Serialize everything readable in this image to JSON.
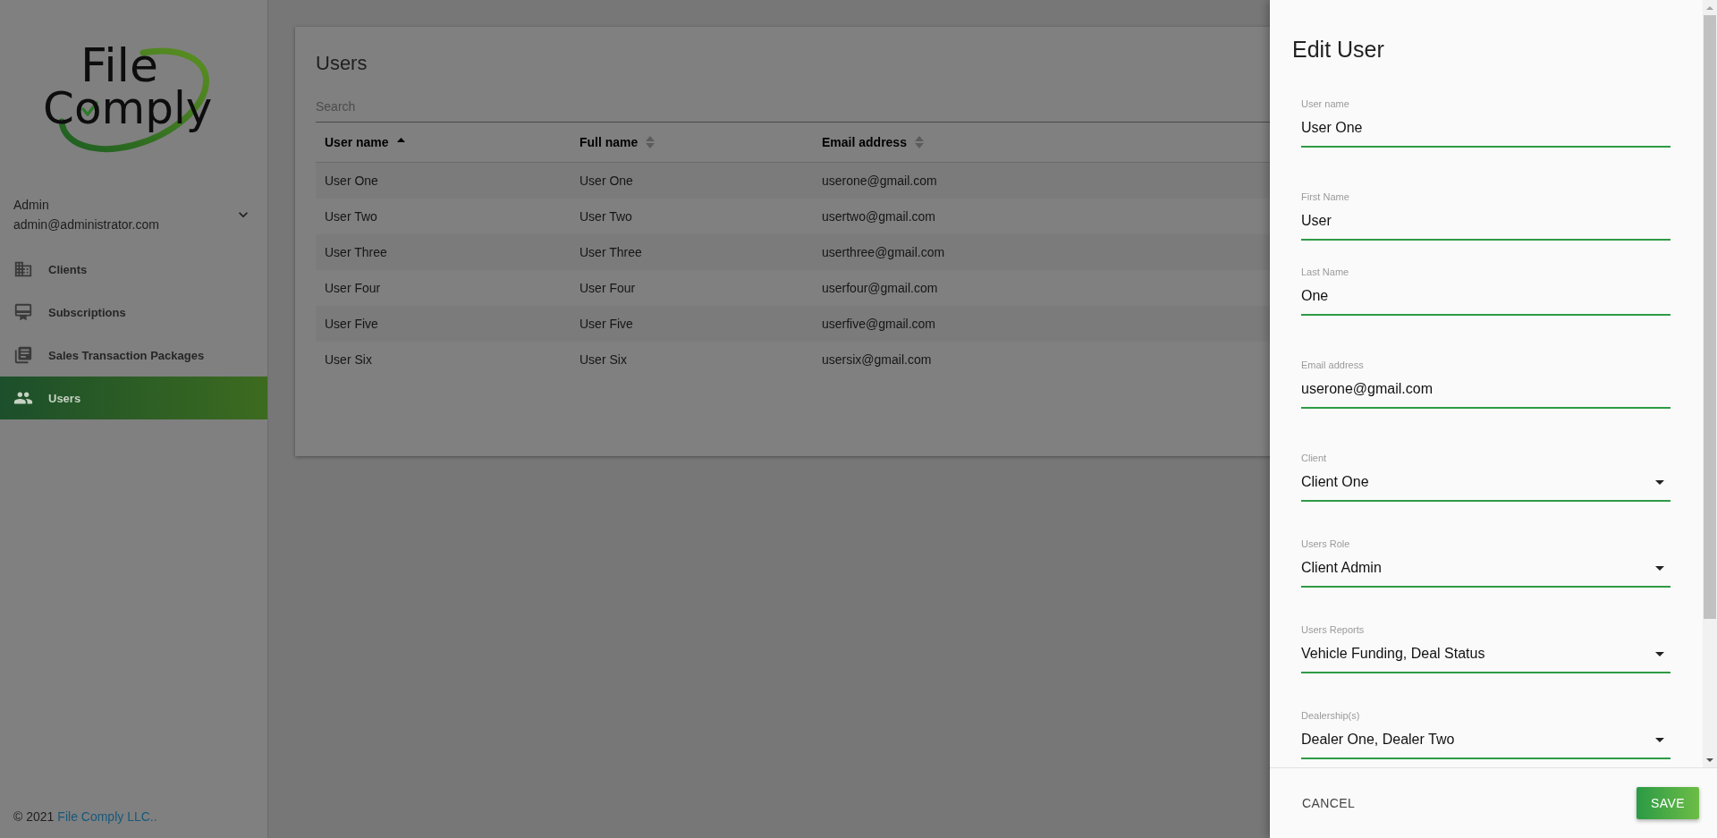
{
  "sidebar": {
    "logo": {
      "line_1": "File",
      "line_2": "Comply"
    },
    "account": {
      "name": "Admin",
      "email": "admin@administrator.com"
    },
    "nav_items": [
      {
        "label": "Clients",
        "selected": false
      },
      {
        "label": "Subscriptions",
        "selected": false
      },
      {
        "label": "Sales Transaction Packages",
        "selected": false
      },
      {
        "label": "Users",
        "selected": true
      }
    ],
    "footer": {
      "copyright": "© 2021",
      "link": "File Comply LLC.."
    }
  },
  "users_card": {
    "title": "Users",
    "search": {
      "placeholder": "Search"
    },
    "table": {
      "columns": [
        {
          "label": "User name",
          "sorted": true
        },
        {
          "label": "Full name",
          "sorted": false
        },
        {
          "label": "Email address",
          "sorted": false
        }
      ],
      "rows": [
        [
          "User One",
          "User One",
          "userone@gmail.com"
        ],
        [
          "User Two",
          "User Two",
          "usertwo@gmail.com"
        ],
        [
          "User Three",
          "User Three",
          "userthree@gmail.com"
        ],
        [
          "User Four",
          "User Four",
          "userfour@gmail.com"
        ],
        [
          "User Five",
          "User Five",
          "userfive@gmail.com"
        ],
        [
          "User Six",
          "User Six",
          "usersix@gmail.com"
        ]
      ]
    }
  },
  "edit_drawer": {
    "title": "Edit User",
    "fields": [
      {
        "kind": "text",
        "label": "User name",
        "value": "User One"
      },
      {
        "kind": "text",
        "label": "First Name",
        "value": "User"
      },
      {
        "kind": "text",
        "label": "Last Name",
        "value": "One"
      },
      {
        "kind": "text",
        "label": "Email address",
        "value": "userone@gmail.com"
      },
      {
        "kind": "select",
        "label": "Client",
        "value": "Client One"
      },
      {
        "kind": "select",
        "label": "Users Role",
        "value": "Client Admin"
      },
      {
        "kind": "select",
        "label": "Users Reports",
        "value": "Vehicle Funding, Deal Status"
      },
      {
        "kind": "select",
        "label": "Dealership(s)",
        "value": "Dealer One, Dealer Two"
      }
    ],
    "buttons": [
      {
        "kind": "text",
        "label": "CANCEL"
      },
      {
        "kind": "primary",
        "label": "SAVE"
      }
    ]
  }
}
